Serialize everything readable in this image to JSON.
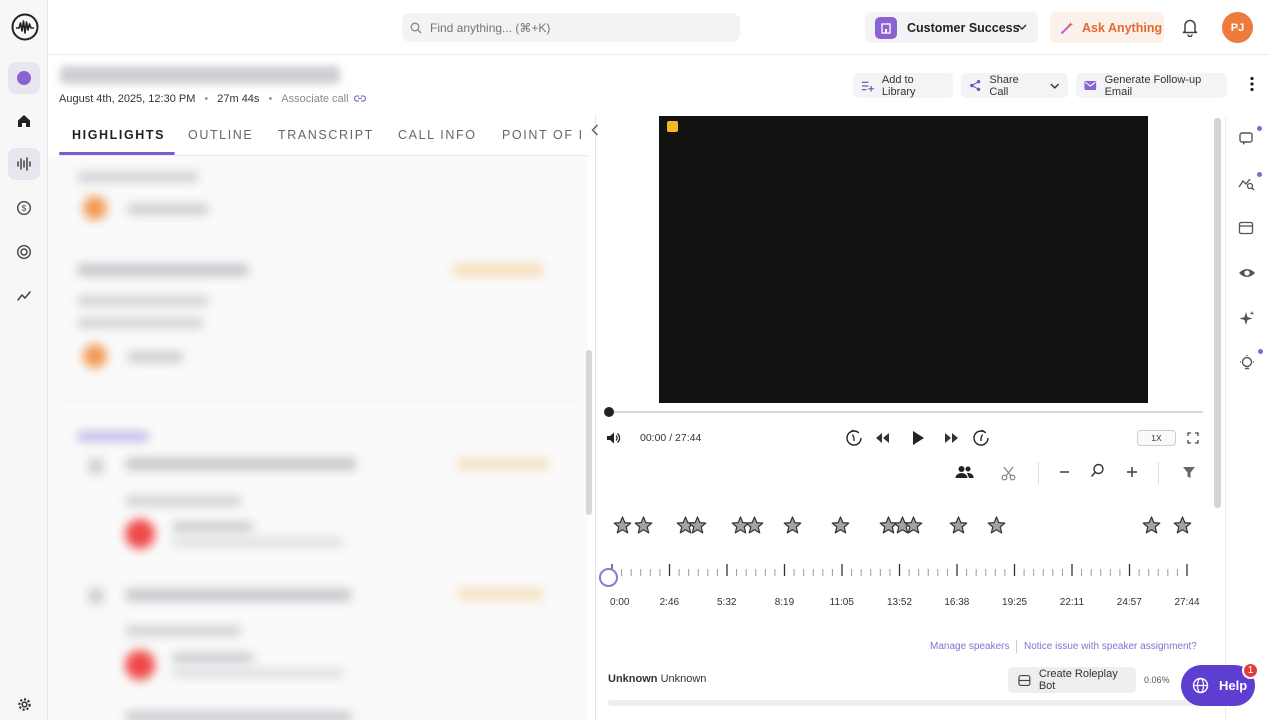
{
  "search": {
    "placeholder": "Find anything... (⌘+K)"
  },
  "workspace": {
    "label": "Customer Success"
  },
  "ask": {
    "label": "Ask Anything"
  },
  "user": {
    "initials": "PJ"
  },
  "call": {
    "date": "August 4th, 2025, 12:30 PM",
    "duration": "27m 44s",
    "associate_label": "Associate call"
  },
  "actions": {
    "add_library": "Add to Library",
    "share_call": "Share Call",
    "follow_up": "Generate Follow-up Email"
  },
  "tabs": [
    {
      "label": "HIGHLIGHTS"
    },
    {
      "label": "OUTLINE"
    },
    {
      "label": "TRANSCRIPT"
    },
    {
      "label": "CALL INFO"
    },
    {
      "label": "POINT OF I"
    }
  ],
  "player": {
    "time": "00:00 / 27:44",
    "speed": "1X",
    "progress": 0
  },
  "timeline": {
    "ticks": [
      "0:00",
      "2:46",
      "5:32",
      "8:19",
      "11:05",
      "13:52",
      "16:38",
      "19:25",
      "22:11",
      "24:57",
      "27:44"
    ],
    "star_times": [
      "0:30",
      "1:30",
      "3:30",
      "4:05",
      "6:10",
      "6:50",
      "8:40",
      "11:00",
      "13:20",
      "14:00",
      "14:30",
      "16:40",
      "18:30",
      "26:00",
      "27:30"
    ]
  },
  "speakers": {
    "manage_label": "Manage speakers",
    "notice_label": "Notice issue with speaker assignment?",
    "name": "Unknown",
    "role": "Unknown",
    "percent": "0.06%"
  },
  "roleplay": {
    "label": "Create Roleplay Bot"
  },
  "help": {
    "label": "Help",
    "badge": "1"
  },
  "colors": {
    "accent": "#7e5ad0",
    "brand_orange": "#ec7b3c",
    "help_bg": "#5d3ed1"
  }
}
